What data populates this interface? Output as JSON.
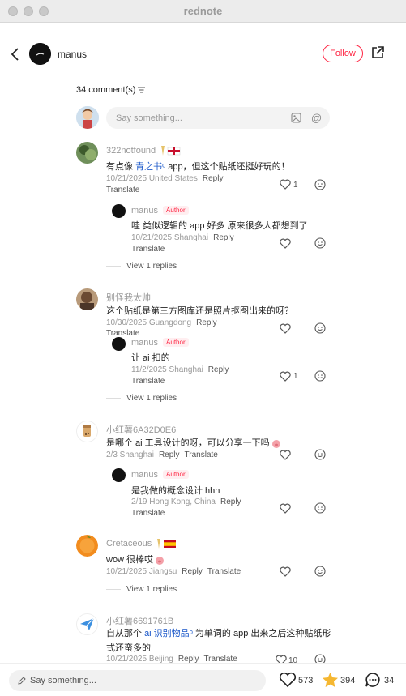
{
  "window": {
    "title": "rednote"
  },
  "header": {
    "author": "manus",
    "follow_label": "Follow"
  },
  "comments_count": "34 comment(s)",
  "input": {
    "placeholder": "Say something..."
  },
  "comments": [
    {
      "user": "322notfound",
      "text_pre": "有点像 ",
      "link": "青之书",
      "text_post": " app，但这个贴纸还挺好玩的！",
      "date": "10/21/2025 United States",
      "reply": "Reply",
      "translate": "Translate",
      "likes": "1",
      "reply_item": {
        "user": "manus",
        "badge": "Author",
        "text": "哇 类似逻辑的 app 好多 原来很多人都想到了",
        "date": "10/21/2025 Shanghai",
        "reply": "Reply",
        "translate": "Translate"
      },
      "view_replies": "View 1 replies"
    },
    {
      "user": "别怪我太帅",
      "text": "这个贴纸是第三方图库还是照片抠图出来的呀？",
      "date": "10/30/2025 Guangdong",
      "reply": "Reply",
      "translate": "Translate",
      "reply_item": {
        "user": "manus",
        "badge": "Author",
        "text": "让 ai 扣的",
        "date": "11/2/2025 Shanghai",
        "reply": "Reply",
        "translate": "Translate",
        "likes": "1"
      },
      "view_replies": "View 1 replies"
    },
    {
      "user": "小红薯6A32D0E6",
      "text": "是哪个 ai 工具设计的呀，可以分享一下吗",
      "date": "2/3 Shanghai",
      "reply": "Reply",
      "translate": "Translate",
      "reply_item": {
        "user": "manus",
        "badge": "Author",
        "text": "是我做的概念设计 hhh",
        "date": "2/19 Hong Kong, China",
        "reply": "Reply",
        "translate": "Translate"
      }
    },
    {
      "user": "Cretaceous",
      "text": "wow 很棒哎",
      "date": "10/21/2025 Jiangsu",
      "reply": "Reply",
      "translate": "Translate",
      "view_replies": "View 1 replies"
    },
    {
      "user": "小红薯6691761B",
      "text_pre": "自从那个 ",
      "link": "ai 识别物品",
      "text_post": " 为单词的 app 出来之后这种贴纸形",
      "text_line2": "式还蛮多的",
      "date": "10/21/2025 Beijing",
      "reply": "Reply",
      "translate": "Translate",
      "likes": "10"
    }
  ],
  "bottom": {
    "placeholder": "Say something...",
    "likes": "573",
    "stars": "394",
    "comments": "34"
  },
  "colors": {
    "accent": "#ff2442",
    "link": "#1a57c9",
    "star": "#f5b731"
  }
}
